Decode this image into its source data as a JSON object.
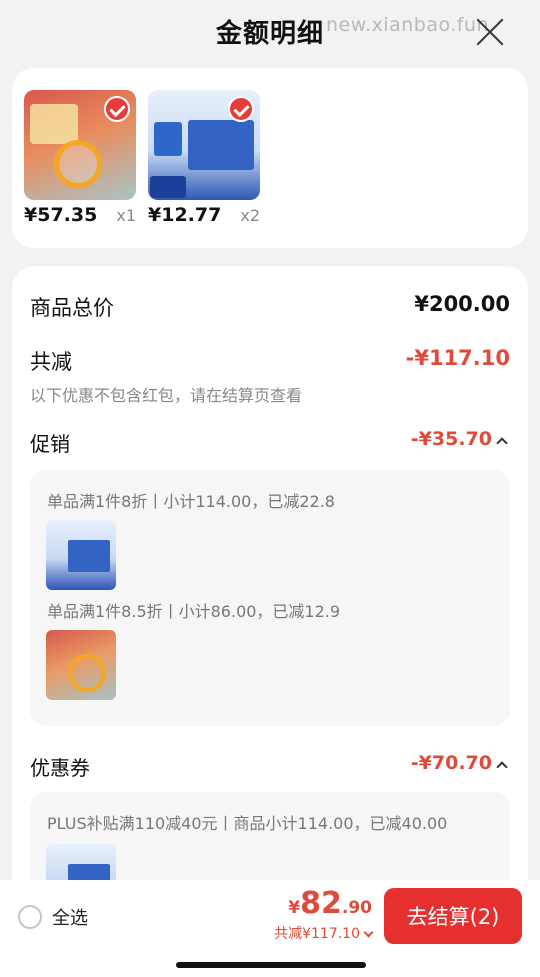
{
  "header": {
    "title": "金额明细",
    "watermark": "new.xianbao.fun"
  },
  "products": [
    {
      "price": "¥57.35",
      "qty": "x1",
      "selected": true
    },
    {
      "price": "¥12.77",
      "qty": "x2",
      "selected": true
    }
  ],
  "summary": {
    "total_label": "商品总价",
    "total_value": "¥200.00",
    "discount_label": "共减",
    "discount_value": "-¥117.10",
    "discount_note": "以下优惠不包含红包，请在结算页查看"
  },
  "promotion": {
    "label": "促销",
    "value": "-¥35.70",
    "rules": [
      {
        "text": "单品满1件8折丨小计114.00，已减22.8"
      },
      {
        "text": "单品满1件8.5折丨小计86.00，已减12.9"
      }
    ]
  },
  "coupon": {
    "label": "优惠券",
    "value": "-¥70.70",
    "rules": [
      {
        "text": "PLUS补贴满110减40元丨商品小计114.00，已减40.00"
      }
    ]
  },
  "footer": {
    "select_all": "全选",
    "currency": "¥",
    "total_int": "82",
    "total_dec": ".90",
    "discount_text": "共减¥117.10",
    "checkout_label": "去结算(2)"
  },
  "colors": {
    "accent": "#e62f2f",
    "discount": "#e04a39"
  }
}
